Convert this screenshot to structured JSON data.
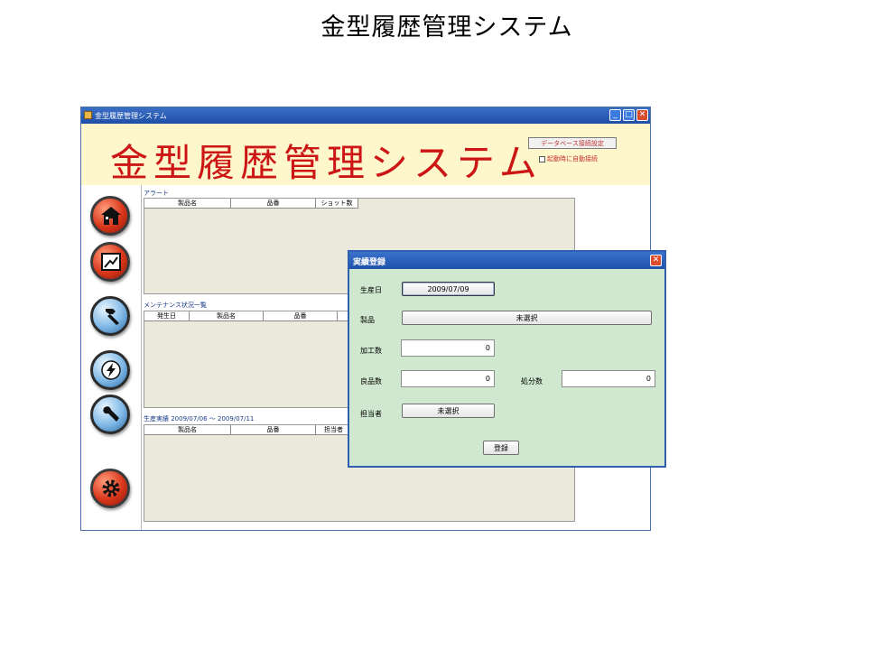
{
  "slide": {
    "title": "金型履歴管理システム"
  },
  "window": {
    "title": "金型履歴管理システム",
    "controls": {
      "minimize": "_",
      "maximize": "□",
      "close": "✕"
    },
    "banner_title": "金型履歴管理システム",
    "db_settings_button": "データベース接続設定",
    "auto_connect_label": "起動時に自動接続"
  },
  "sidebar": {
    "buttons": [
      {
        "name": "home",
        "icon": "home-icon",
        "color": "red"
      },
      {
        "name": "chart",
        "icon": "chart-icon",
        "color": "red"
      },
      {
        "name": "hammer",
        "icon": "hammer-icon",
        "color": "blue"
      },
      {
        "name": "power",
        "icon": "lightning-icon",
        "color": "blue"
      },
      {
        "name": "wrench",
        "icon": "wrench-icon",
        "color": "blue"
      },
      {
        "name": "settings",
        "icon": "gear-icon",
        "color": "red"
      }
    ]
  },
  "alert": {
    "label": "アラート",
    "columns": [
      "製品名",
      "品番",
      "ショット数"
    ]
  },
  "maintenance": {
    "label": "メンテナンス状況一覧",
    "columns": [
      "発生日",
      "製品名",
      "品番",
      ""
    ]
  },
  "production": {
    "label": "生産実績 2009/07/06 〜 2009/07/11",
    "columns": [
      "製品名",
      "品番",
      "担当者"
    ]
  },
  "dialog": {
    "title": "実績登録",
    "close": "✕",
    "date_label": "生産日",
    "date_value": "2009/07/09",
    "product_label": "製品",
    "product_value": "未選択",
    "processed_label": "加工数",
    "processed_value": "0",
    "good_label": "良品数",
    "good_value": "0",
    "disposal_label": "処分数",
    "disposal_value": "0",
    "person_label": "担当者",
    "person_value": "未選択",
    "register_button": "登録"
  }
}
